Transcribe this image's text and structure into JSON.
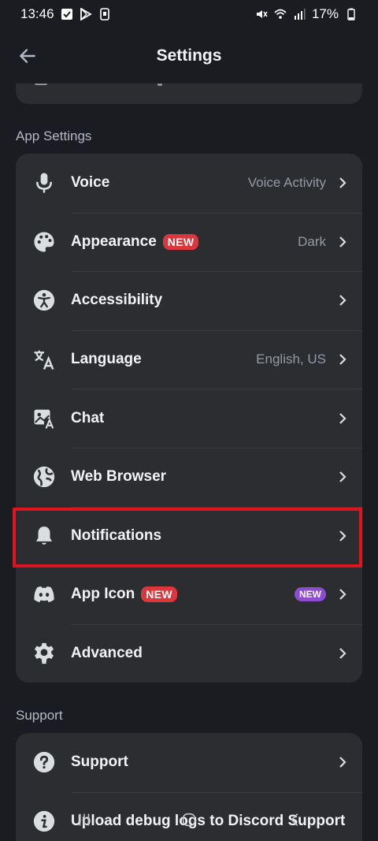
{
  "status_bar": {
    "time": "13:46",
    "battery": "17%"
  },
  "header": {
    "title": "Settings"
  },
  "sections": {
    "app_settings": "App Settings",
    "support": "Support"
  },
  "app_settings_items": [
    {
      "label": "Voice",
      "value": "Voice Activity",
      "icon": "microphone-icon"
    },
    {
      "label": "Appearance",
      "badge": "NEW",
      "value": "Dark",
      "icon": "palette-icon"
    },
    {
      "label": "Accessibility",
      "icon": "accessibility-icon"
    },
    {
      "label": "Language",
      "value": "English, US",
      "icon": "translate-icon"
    },
    {
      "label": "Chat",
      "icon": "chat-image-icon"
    },
    {
      "label": "Web Browser",
      "icon": "globe-icon"
    },
    {
      "label": "Notifications",
      "icon": "bell-icon"
    },
    {
      "label": "App Icon",
      "badge": "NEW",
      "trailing_badge": "NEW",
      "icon": "discord-icon"
    },
    {
      "label": "Advanced",
      "icon": "gear-icon"
    }
  ],
  "support_items": [
    {
      "label": "Support",
      "icon": "question-icon"
    },
    {
      "label": "Upload debug logs to Discord Support",
      "icon": "info-icon"
    }
  ],
  "colors": {
    "background": "#1b1c21",
    "card": "#2b2d31",
    "new_badge": "#da373c",
    "new_badge_purple": "#8d4bce",
    "highlight": "#e0141e"
  }
}
